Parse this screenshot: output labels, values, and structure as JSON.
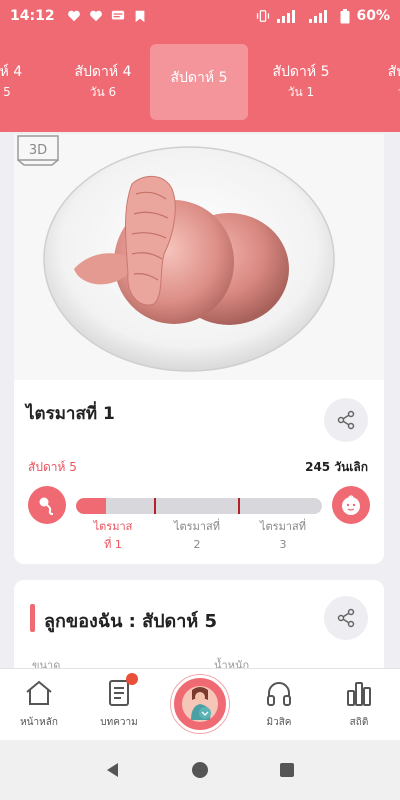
{
  "status_bar": {
    "time": "14:12",
    "battery": "60%"
  },
  "week_tabs": [
    {
      "label": "าห์ 4",
      "sub": "5"
    },
    {
      "label": "สัปดาห์ 4",
      "sub": "วัน 6"
    },
    {
      "label": "สัปดาห์ 5",
      "sub": ""
    },
    {
      "label": "สัปดาห์ 5",
      "sub": "วัน 1"
    },
    {
      "label": "สัปด",
      "sub": "วั"
    }
  ],
  "active_week_index": 2,
  "hero": {
    "badge": "3D"
  },
  "trimester": {
    "title": "ไตรมาสที่ 1",
    "week_label": "สัปดาห์ 5",
    "days_left": "245 วันเลิก",
    "progress_fraction": 0.12,
    "labels": [
      {
        "line1": "ไตรมาส",
        "line2": "ที่ 1"
      },
      {
        "line1": "ไตรมาสที่",
        "line2": "2"
      },
      {
        "line1": "ไตรมาสที่",
        "line2": "3"
      }
    ]
  },
  "baby_card": {
    "title": "ลูกของฉัน : สัปดาห์ 5",
    "col1": "ขนาด",
    "col2": "น้ำหนัก"
  },
  "bottom_nav": {
    "home": "หน้าหลัก",
    "articles": "บทความ",
    "center": "",
    "music": "มิวสิค",
    "stats": "สถิติ"
  },
  "colors": {
    "brand": "#f06a73",
    "accent_dark": "#b2202c"
  }
}
